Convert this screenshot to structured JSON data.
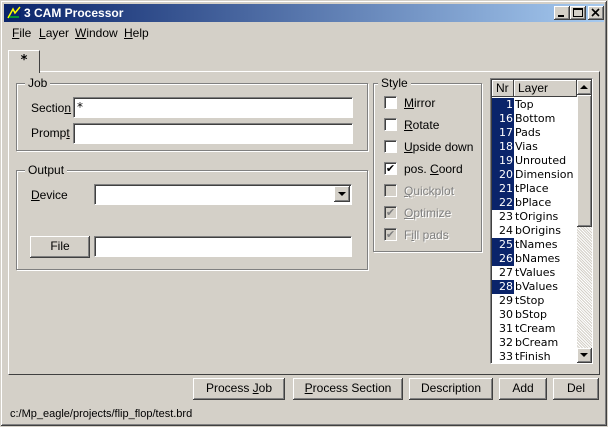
{
  "window": {
    "title": "3 CAM Processor",
    "colors": {
      "titlebar": "#0a246a",
      "face": "#d4d0c8",
      "selection": "#0a246a"
    }
  },
  "menu": [
    {
      "underline": "F",
      "rest": "ile"
    },
    {
      "underline": "L",
      "rest": "ayer"
    },
    {
      "underline": "W",
      "rest": "indow"
    },
    {
      "underline": "H",
      "rest": "elp"
    }
  ],
  "tab": {
    "label": "*"
  },
  "job": {
    "label": "Job",
    "section_label_a": "Sectio",
    "section_label_u": "n",
    "section_value": "*",
    "prompt_label_a": "Promp",
    "prompt_label_u": "t",
    "prompt_value": ""
  },
  "output": {
    "label": "Output",
    "device_label_u": "D",
    "device_label_rest": "evice",
    "device_value": "",
    "file_button": "File",
    "file_value": ""
  },
  "style": {
    "label": "Style",
    "options": [
      {
        "pre": "",
        "u": "M",
        "post": "irror",
        "checked": false,
        "enabled": true
      },
      {
        "pre": "",
        "u": "R",
        "post": "otate",
        "checked": false,
        "enabled": true
      },
      {
        "pre": "",
        "u": "U",
        "post": "pside down",
        "checked": false,
        "enabled": true
      },
      {
        "pre": "pos. ",
        "u": "C",
        "post": "oord",
        "checked": true,
        "enabled": true
      },
      {
        "pre": "",
        "u": "Q",
        "post": "uickplot",
        "checked": false,
        "enabled": false
      },
      {
        "pre": "",
        "u": "O",
        "post": "ptimize",
        "checked": true,
        "enabled": false
      },
      {
        "pre": "F",
        "u": "i",
        "post": "ll pads",
        "checked": true,
        "enabled": false
      }
    ],
    "check_glyph": "✔"
  },
  "layers": {
    "headers": {
      "nr": "Nr",
      "layer": "Layer"
    },
    "rows": [
      {
        "nr": "1",
        "name": "Top",
        "selected": true
      },
      {
        "nr": "16",
        "name": "Bottom",
        "selected": true
      },
      {
        "nr": "17",
        "name": "Pads",
        "selected": true
      },
      {
        "nr": "18",
        "name": "Vias",
        "selected": true
      },
      {
        "nr": "19",
        "name": "Unrouted",
        "selected": true
      },
      {
        "nr": "20",
        "name": "Dimension",
        "selected": true
      },
      {
        "nr": "21",
        "name": "tPlace",
        "selected": true
      },
      {
        "nr": "22",
        "name": "bPlace",
        "selected": true
      },
      {
        "nr": "23",
        "name": "tOrigins",
        "selected": false
      },
      {
        "nr": "24",
        "name": "bOrigins",
        "selected": false
      },
      {
        "nr": "25",
        "name": "tNames",
        "selected": true
      },
      {
        "nr": "26",
        "name": "bNames",
        "selected": true
      },
      {
        "nr": "27",
        "name": "tValues",
        "selected": false
      },
      {
        "nr": "28",
        "name": "bValues",
        "selected": true
      },
      {
        "nr": "29",
        "name": "tStop",
        "selected": false
      },
      {
        "nr": "30",
        "name": "bStop",
        "selected": false
      },
      {
        "nr": "31",
        "name": "tCream",
        "selected": false
      },
      {
        "nr": "32",
        "name": "bCream",
        "selected": false
      },
      {
        "nr": "33",
        "name": "tFinish",
        "selected": false
      }
    ]
  },
  "buttons": {
    "process_job_a": "Process ",
    "process_job_u": "J",
    "process_job_b": "ob",
    "process_section_u": "P",
    "process_section_rest": "rocess Section",
    "description": "Description",
    "add": "Add",
    "del": "Del"
  },
  "status": {
    "path": "c:/Mp_eagle/projects/flip_flop/test.brd"
  }
}
